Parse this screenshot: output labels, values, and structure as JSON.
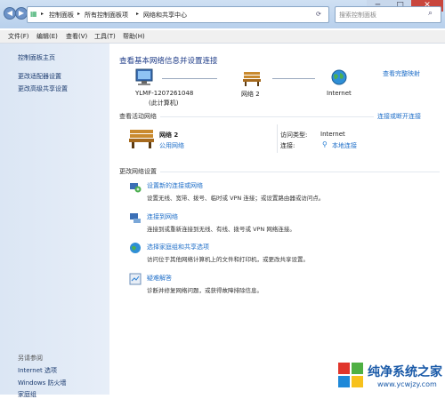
{
  "address": {
    "crumbs": [
      "控制面板",
      "所有控制面板项",
      "网络和共享中心"
    ],
    "search_placeholder": "搜索控制面板"
  },
  "menu": [
    "文件(F)",
    "编辑(E)",
    "查看(V)",
    "工具(T)",
    "帮助(H)"
  ],
  "sidebar": {
    "items": [
      "控制面板主页",
      "更改适配器设置",
      "更改高级共享设置"
    ],
    "see_also_title": "另请参阅",
    "see_also": [
      "Internet 选项",
      "Windows 防火墙",
      "家庭组"
    ]
  },
  "main": {
    "title": "查看基本网络信息并设置连接",
    "full_map": "查看完整映射",
    "map": {
      "computer_name": "YLMF-1207261048",
      "computer_sub": "(此计算机)",
      "network_name": "网络  2",
      "internet": "Internet"
    },
    "active_title": "查看活动网络",
    "connect_disconnect": "连接或断开连接",
    "active": {
      "name": "网络  2",
      "type": "公用网络",
      "access_label": "访问类型:",
      "access_value": "Internet",
      "conn_label": "连接:",
      "conn_value": "本地连接"
    },
    "change_title": "更改网络设置",
    "tasks": [
      {
        "title": "设置新的连接或网络",
        "desc": "设置无线、宽带、拨号、临时或 VPN 连接；或设置路由器或访问点。"
      },
      {
        "title": "连接到网络",
        "desc": "连接到或重新连接到无线、有线、拨号或 VPN 网络连接。"
      },
      {
        "title": "选择家庭组和共享选项",
        "desc": "访问位于其他网络计算机上的文件和打印机，或更改共享设置。"
      },
      {
        "title": "疑难解答",
        "desc": "诊断并修复网络问题，或获得故障排除信息。"
      }
    ]
  },
  "watermark": {
    "name": "纯净系统之家",
    "url": "www.ycwjzy.com"
  }
}
